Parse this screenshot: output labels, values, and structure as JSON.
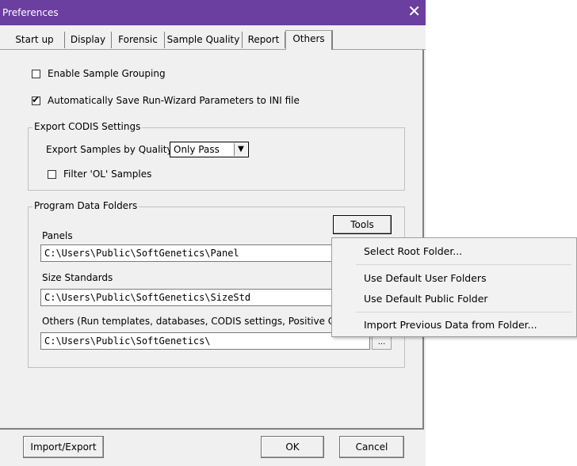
{
  "window": {
    "title": "Preferences",
    "close_glyph": "✕"
  },
  "tabs": [
    {
      "label": "Start up"
    },
    {
      "label": "Display"
    },
    {
      "label": "Forensic"
    },
    {
      "label": "Sample Quality"
    },
    {
      "label": "Report"
    },
    {
      "label": "Others",
      "active": true
    }
  ],
  "options": {
    "enable_grouping": {
      "label": "Enable Sample Grouping",
      "checked": false
    },
    "auto_save": {
      "label": "Automatically Save Run-Wizard Parameters to INI file",
      "checked": true
    }
  },
  "codis": {
    "group_title": "Export CODIS Settings",
    "quality_label": "Export Samples by Quality:",
    "quality_value": "Only Pass",
    "filter_ol": {
      "label": "Filter 'OL' Samples",
      "checked": false
    }
  },
  "folders": {
    "group_title": "Program Data Folders",
    "tools_label": "Tools",
    "panels_label": "Panels",
    "panels_path": "C:\\Users\\Public\\SoftGenetics\\Panel",
    "size_label": "Size Standards",
    "size_path": "C:\\Users\\Public\\SoftGenetics\\SizeStd",
    "others_label": "Others (Run templates, databases, CODIS settings, Positive Contro",
    "others_path": "C:\\Users\\Public\\SoftGenetics\\",
    "browse_label": "..."
  },
  "tools_menu": {
    "items": [
      "Select Root Folder...",
      "Use Default User Folders",
      "Use Default Public Folder",
      "Import Previous Data from Folder..."
    ]
  },
  "footer": {
    "import_export": "Import/Export",
    "ok": "OK",
    "cancel": "Cancel"
  }
}
